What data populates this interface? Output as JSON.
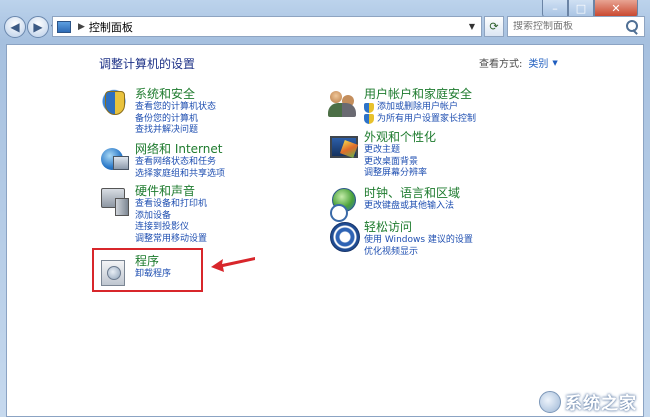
{
  "window": {
    "caption_buttons": [
      "–",
      "□",
      "✕"
    ],
    "address": "控制面板",
    "search_placeholder": "搜索控制面板"
  },
  "header": {
    "title": "调整计算机的设置",
    "view_by_label": "查看方式:",
    "view_by_value": "类别"
  },
  "categories": [
    {
      "icon": "security-shield-icon",
      "title": "系统和安全",
      "links": [
        "查看您的计算机状态",
        "备份您的计算机",
        "查找并解决问题"
      ]
    },
    {
      "icon": "network-globe-icon",
      "title": "网络和 Internet",
      "links": [
        "查看网络状态和任务",
        "选择家庭组和共享选项"
      ]
    },
    {
      "icon": "hardware-printer-icon",
      "title": "硬件和声音",
      "links": [
        "查看设备和打印机",
        "添加设备",
        "连接到投影仪",
        "调整常用移动设置"
      ]
    },
    {
      "icon": "programs-disc-icon",
      "title": "程序",
      "links": [
        "卸载程序"
      ]
    },
    {
      "icon": "users-icon",
      "title": "用户帐户和家庭安全",
      "links": [
        "添加或删除用户帐户",
        "为所有用户设置家长控制"
      ]
    },
    {
      "icon": "appearance-monitor-icon",
      "title": "外观和个性化",
      "links": [
        "更改主题",
        "更改桌面背景",
        "调整屏幕分辨率"
      ]
    },
    {
      "icon": "clock-globe-icon",
      "title": "时钟、语言和区域",
      "links": [
        "更改键盘或其他输入法"
      ]
    },
    {
      "icon": "ease-of-access-icon",
      "title": "轻松访问",
      "links": [
        "使用 Windows 建议的设置",
        "优化视频显示"
      ]
    }
  ],
  "watermark": "系统之家",
  "colors": {
    "category_title": "#1e7b2e",
    "link": "#1f4fb1",
    "highlight": "#d8262b",
    "heading": "#1e3287"
  }
}
